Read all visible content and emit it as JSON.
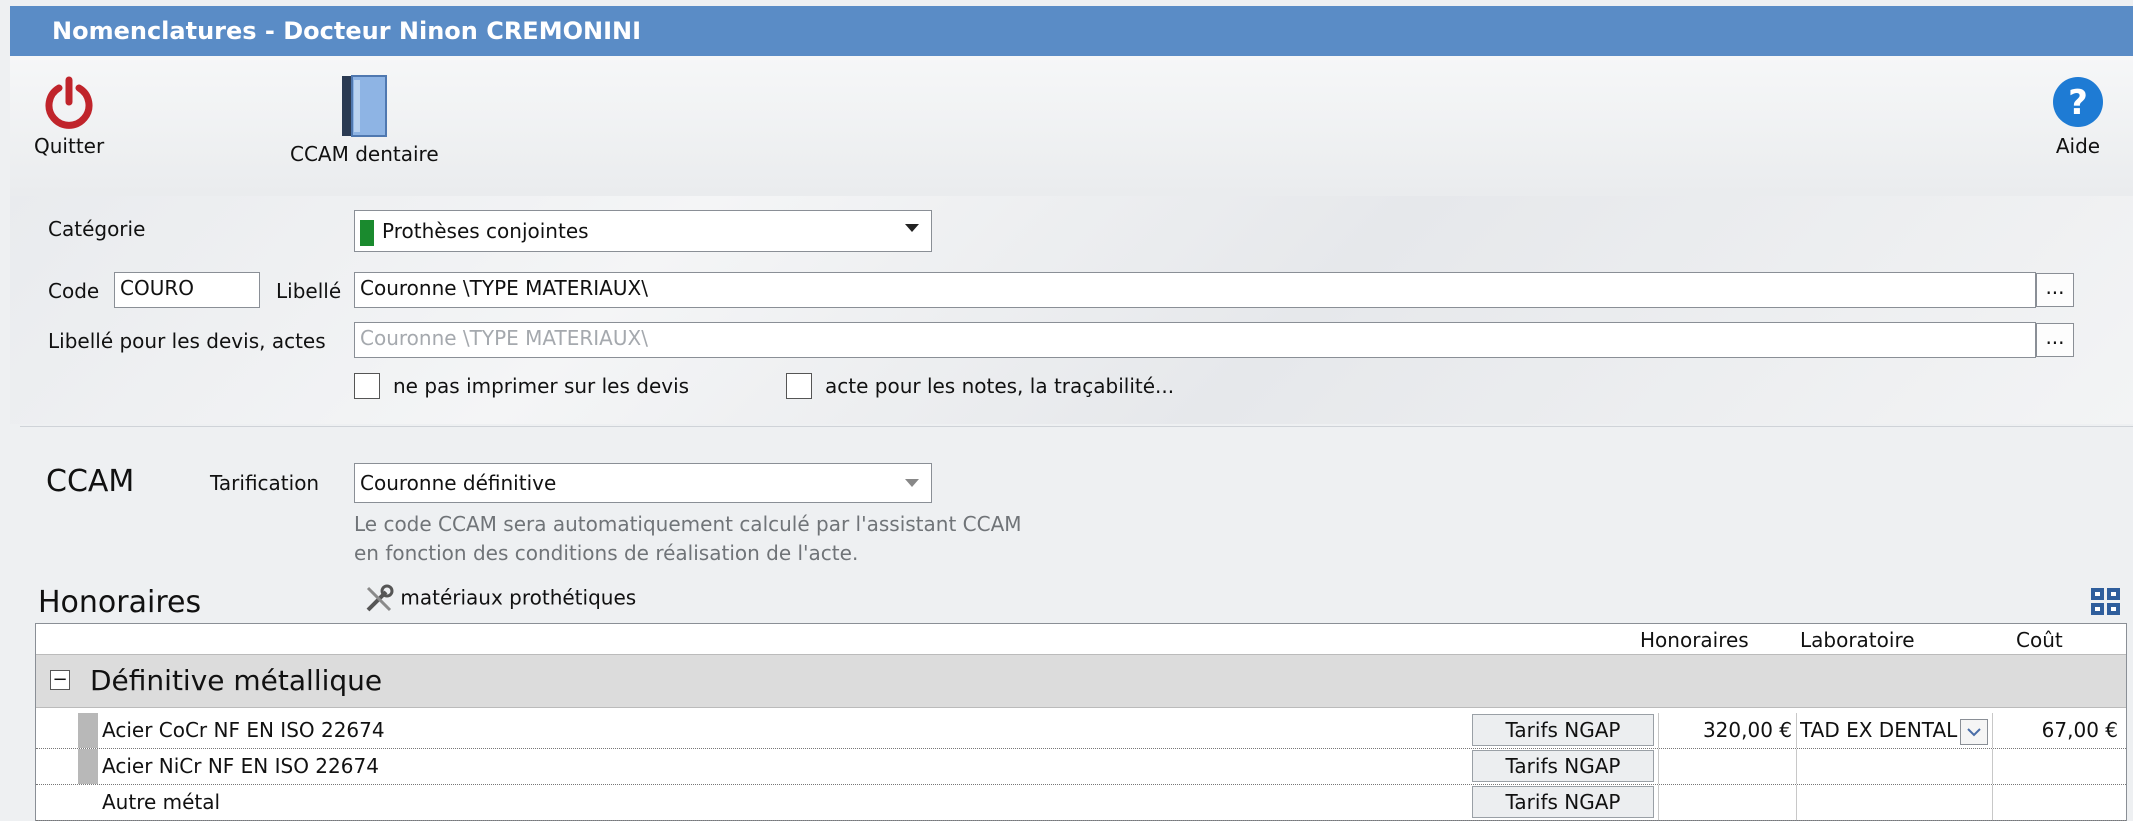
{
  "window": {
    "title": "Nomenclatures - Docteur Ninon CREMONINI"
  },
  "toolbar": {
    "quit_label": "Quitter",
    "ccam_label": "CCAM dentaire",
    "help_label": "Aide"
  },
  "form": {
    "categorie_label": "Catégorie",
    "categorie_value": "Prothèses conjointes",
    "categorie_color": "#1a8a2e",
    "code_label": "Code",
    "code_value": "COURO",
    "libelle_label": "Libellé",
    "libelle_value": "Couronne  \\TYPE MATERIAUX\\",
    "libelle_devis_label": "Libellé pour les devis, actes",
    "libelle_devis_placeholder": "Couronne  \\TYPE MATERIAUX\\",
    "ellipsis": "...",
    "check_no_print": "ne pas imprimer sur les devis",
    "check_notes": "acte pour les notes, la traçabilité..."
  },
  "ccam": {
    "title": "CCAM",
    "tarification_label": "Tarification",
    "tarification_value": "Couronne définitive",
    "hint_line1": "Le code CCAM sera automatiquement calculé par l'assistant CCAM",
    "hint_line2": "en fonction des conditions de réalisation de l'acte."
  },
  "honoraires": {
    "title": "Honoraires",
    "materials_label": "matériaux prothétiques",
    "columns": {
      "honoraires": "Honoraires",
      "laboratoire": "Laboratoire",
      "cout": "Coût"
    },
    "group": {
      "toggle": "−",
      "label": "Définitive métallique"
    },
    "rows": [
      {
        "name": "Acier CoCr NF EN ISO 22674",
        "tarif": "Tarifs NGAP",
        "honoraires": "320,00 €",
        "laboratoire": "TAD EX DENTAL",
        "cout": "67,00 €"
      },
      {
        "name": "Acier NiCr NF EN ISO 22674",
        "tarif": "Tarifs NGAP",
        "honoraires": "",
        "laboratoire": "",
        "cout": ""
      },
      {
        "name": "Autre métal",
        "tarif": "Tarifs NGAP",
        "honoraires": "",
        "laboratoire": "",
        "cout": ""
      }
    ]
  },
  "colors": {
    "titlebar": "#5a8cc6",
    "quit_icon": "#c0242b",
    "help_icon": "#1e7bd4"
  }
}
